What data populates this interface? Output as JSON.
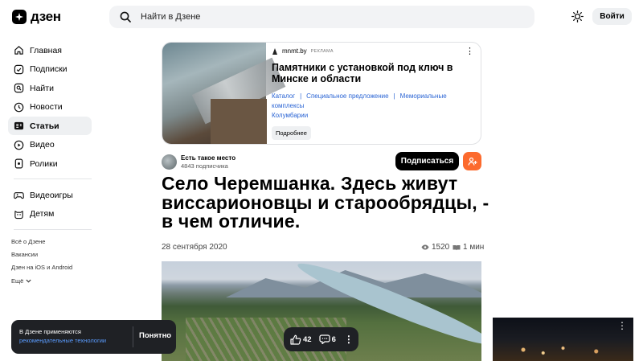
{
  "header": {
    "logo_text": "дзен",
    "search_placeholder": "Найти в Дзене",
    "login_label": "Войти"
  },
  "sidebar": {
    "items": [
      {
        "label": "Главная",
        "icon": "home-icon"
      },
      {
        "label": "Подписки",
        "icon": "subscriptions-icon"
      },
      {
        "label": "Найти",
        "icon": "search-icon"
      },
      {
        "label": "Новости",
        "icon": "news-icon"
      },
      {
        "label": "Статьи",
        "icon": "articles-icon",
        "active": true
      },
      {
        "label": "Видео",
        "icon": "video-icon"
      },
      {
        "label": "Ролики",
        "icon": "shorts-icon"
      }
    ],
    "items2": [
      {
        "label": "Видеоигры",
        "icon": "gamepad-icon"
      },
      {
        "label": "Детям",
        "icon": "kids-icon"
      }
    ],
    "footer": [
      "Всё о Дзене",
      "Вакансии",
      "Дзен на iOS и Android",
      "Ещё"
    ]
  },
  "ad": {
    "source": "mnmt.by",
    "tag": "РЕКЛАМА",
    "title": "Памятники с установкой под ключ в Минске и области",
    "links": [
      "Каталог",
      "Специальное предложение",
      "Мемориальные комплексы",
      "Колумбарии"
    ],
    "more_label": "Подробнее"
  },
  "channel": {
    "name": "Есть такое место",
    "subscribers": "4843 подписчика",
    "subscribe_label": "Подписаться"
  },
  "article": {
    "title": "Село Черемшанка. Здесь живут виссарионовцы и старообрядцы, - в чем отличие.",
    "date": "28 сентября 2020",
    "views": "1520",
    "read_time": "1 мин"
  },
  "cookie": {
    "text_line1": "В Дзене применяются",
    "link_text": "рекомендательные технологии",
    "ok_label": "Понятно"
  },
  "actions": {
    "likes": "42",
    "comments": "6"
  },
  "colors": {
    "accent_orange": "#fc6a2d",
    "link_blue": "#2a64d4",
    "dark_bar": "#1f2125"
  }
}
